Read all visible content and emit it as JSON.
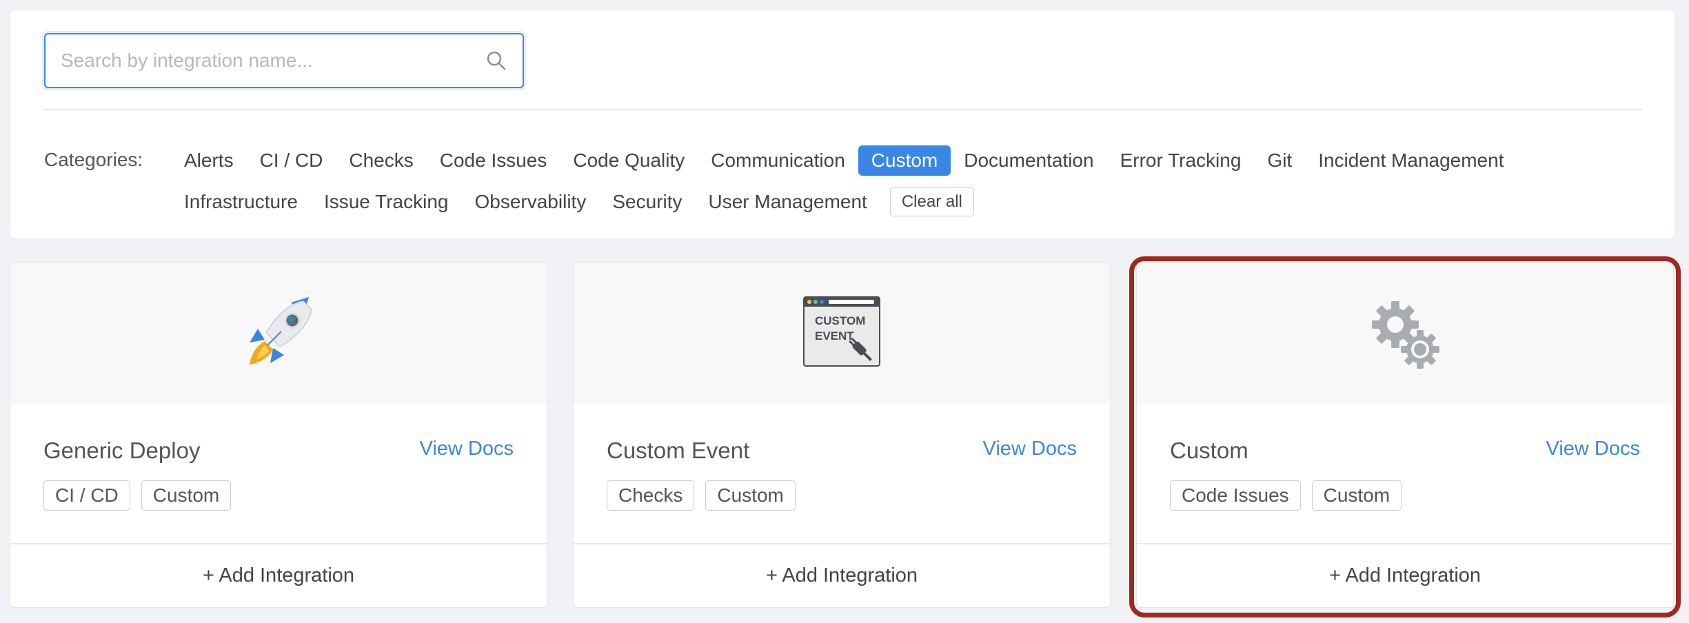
{
  "search": {
    "placeholder": "Search by integration name...",
    "value": ""
  },
  "categories": {
    "label": "Categories:",
    "row1": [
      "Alerts",
      "CI / CD",
      "Checks",
      "Code Issues",
      "Code Quality",
      "Communication",
      "Custom",
      "Documentation",
      "Error Tracking",
      "Git",
      "Incident Management"
    ],
    "row2": [
      "Infrastructure",
      "Issue Tracking",
      "Observability",
      "Security",
      "User Management"
    ],
    "active": "Custom",
    "clear_label": "Clear all"
  },
  "cards": [
    {
      "title": "Generic Deploy",
      "docs_label": "View Docs",
      "tags": [
        "CI / CD",
        "Custom"
      ],
      "add_label": "+ Add Integration",
      "icon": "rocket-icon"
    },
    {
      "title": "Custom Event",
      "docs_label": "View Docs",
      "tags": [
        "Checks",
        "Custom"
      ],
      "add_label": "+ Add Integration",
      "icon": "custom-event-icon",
      "icon_text": [
        "CUSTOM",
        "EVENT"
      ]
    },
    {
      "title": "Custom",
      "docs_label": "View Docs",
      "tags": [
        "Code Issues",
        "Custom"
      ],
      "add_label": "+ Add Integration",
      "icon": "gears-icon"
    }
  ],
  "colors": {
    "accent": "#3a86e6",
    "highlight": "#a0281f"
  }
}
